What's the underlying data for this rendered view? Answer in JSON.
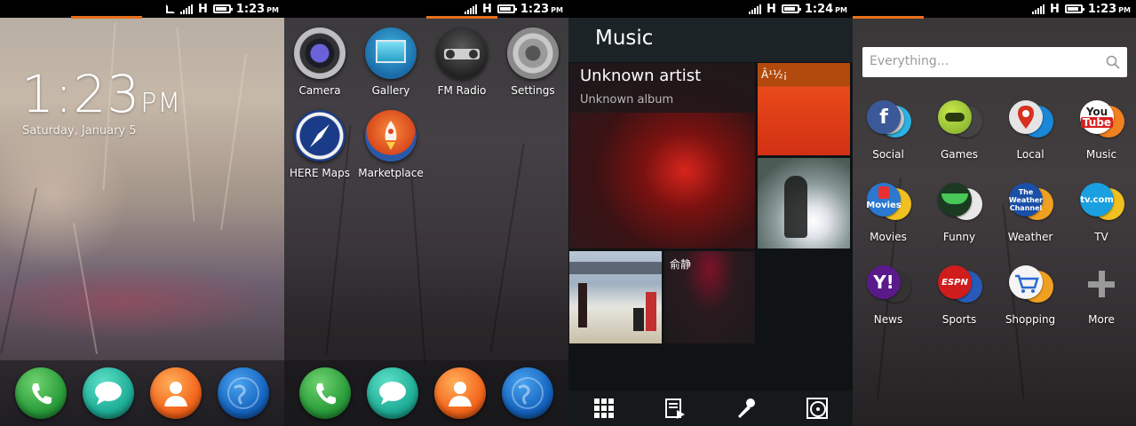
{
  "lockscreen": {
    "status": {
      "time": "1:23",
      "ampm": "PM",
      "network": "H"
    },
    "clock": {
      "time": "1:23",
      "ampm": "PM"
    },
    "date": "Saturday, January 5",
    "dock": [
      "phone-icon",
      "messages-icon",
      "contacts-icon",
      "browser-icon"
    ]
  },
  "homescreen": {
    "status": {
      "time": "1:23",
      "ampm": "PM",
      "network": "H"
    },
    "apps": [
      {
        "label": "Camera",
        "icon": "camera-icon"
      },
      {
        "label": "Gallery",
        "icon": "gallery-icon"
      },
      {
        "label": "FM Radio",
        "icon": "radio-icon"
      },
      {
        "label": "Settings",
        "icon": "gear-icon"
      },
      {
        "label": "HERE Maps",
        "icon": "compass-icon"
      },
      {
        "label": "Marketplace",
        "icon": "rocket-icon"
      }
    ]
  },
  "music": {
    "status": {
      "time": "1:24",
      "ampm": "PM",
      "network": "H"
    },
    "header": "Music",
    "tiles": [
      {
        "title": "Unknown artist",
        "subtitle": "Unknown album"
      },
      {
        "title": "Â¹½¡"
      },
      {
        "title": ""
      },
      {
        "title": ""
      },
      {
        "title": "俞静"
      }
    ],
    "tabs": [
      "grid-view-icon",
      "playlist-icon",
      "artist-icon",
      "album-icon"
    ]
  },
  "everything": {
    "status": {
      "time": "1:23",
      "ampm": "PM",
      "network": "H"
    },
    "search": {
      "placeholder": "Everything..."
    },
    "categories": [
      {
        "label": "Social",
        "icon": "social-icon"
      },
      {
        "label": "Games",
        "icon": "games-icon"
      },
      {
        "label": "Local",
        "icon": "local-icon"
      },
      {
        "label": "Music",
        "icon": "music-icon"
      },
      {
        "label": "Movies",
        "icon": "movies-icon"
      },
      {
        "label": "Funny",
        "icon": "funny-icon"
      },
      {
        "label": "Weather",
        "icon": "weather-icon"
      },
      {
        "label": "TV",
        "icon": "tv-icon"
      },
      {
        "label": "News",
        "icon": "news-icon"
      },
      {
        "label": "Sports",
        "icon": "sports-icon"
      },
      {
        "label": "Shopping",
        "icon": "shopping-icon"
      },
      {
        "label": "More",
        "icon": "plus-icon"
      }
    ]
  },
  "colors": {
    "accent": "#e8701b"
  }
}
